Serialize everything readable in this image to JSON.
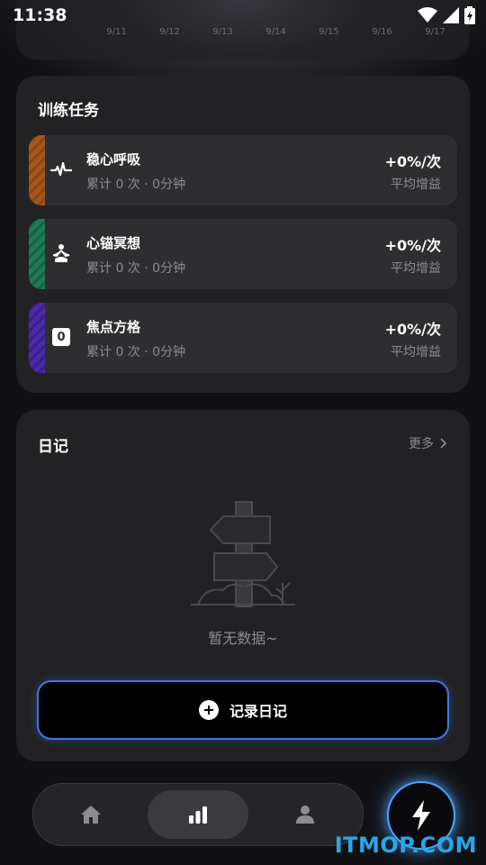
{
  "status_bar": {
    "time": "11:38"
  },
  "date_strip": {
    "dates": [
      "9/11",
      "9/12",
      "9/13",
      "9/14",
      "9/15",
      "9/16",
      "9/17"
    ]
  },
  "training": {
    "title": "训练任务",
    "tasks": [
      {
        "name": "稳心呼吸",
        "summary": "累计 0 次 · 0分钟",
        "rate": "+0%/次",
        "rate_label": "平均增益",
        "icon": "pulse-icon",
        "accent": "#a7561a"
      },
      {
        "name": "心锚冥想",
        "summary": "累计 0 次 · 0分钟",
        "rate": "+0%/次",
        "rate_label": "平均增益",
        "icon": "meditation-icon",
        "accent": "#1f7a55"
      },
      {
        "name": "焦点方格",
        "summary": "累计 0 次 · 0分钟",
        "rate": "+0%/次",
        "rate_label": "平均增益",
        "icon": "number-square-icon",
        "icon_text": "0",
        "accent": "#4a2aa6"
      }
    ]
  },
  "diary": {
    "title": "日记",
    "more_label": "更多",
    "empty_text": "暂无数据~",
    "record_label": "记录日记"
  },
  "nav": {
    "items": [
      "home-icon",
      "stats-icon",
      "profile-icon"
    ],
    "active": "stats-icon"
  },
  "fab": {
    "icon": "lightning-icon",
    "accent": "#4aa3ff"
  },
  "watermark": "ITMOP.COM"
}
